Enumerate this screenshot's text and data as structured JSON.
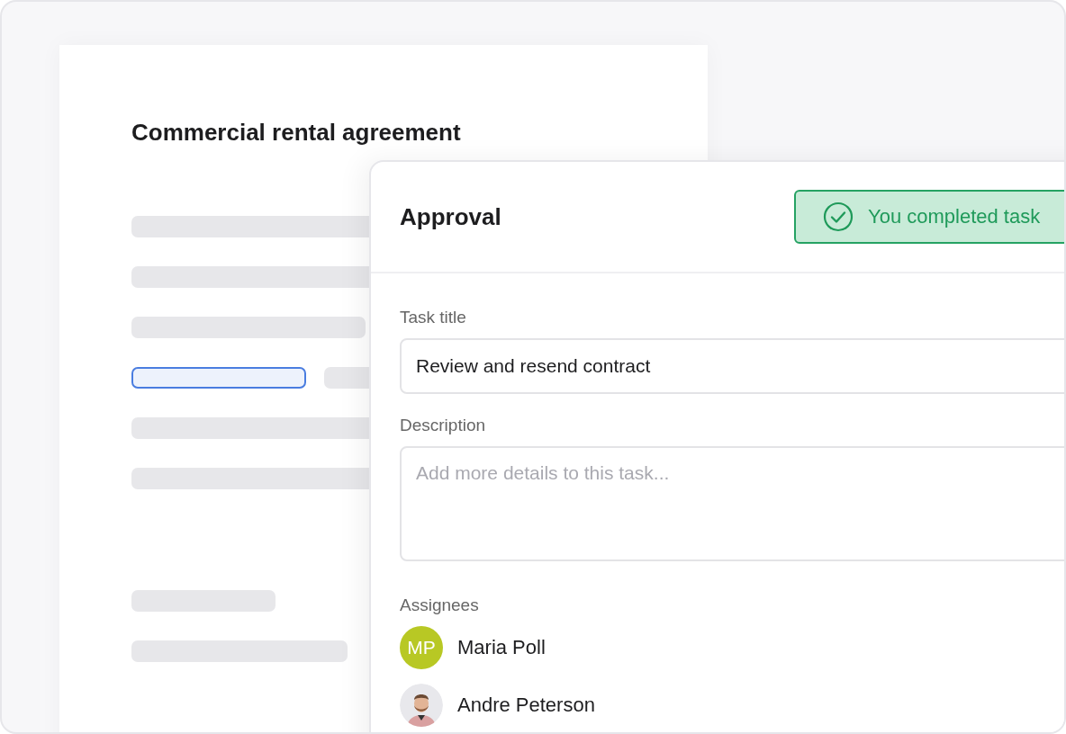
{
  "document": {
    "title": "Commercial rental agreement",
    "lines": [
      {
        "selected": false
      },
      {
        "selected": false
      },
      {
        "selected": false
      },
      {
        "selected": true
      },
      {
        "selected": false
      },
      {
        "selected": false
      },
      {
        "selected": false
      },
      {
        "selected": false
      }
    ]
  },
  "panel": {
    "title": "Approval",
    "badge": "You completed task",
    "fields": [
      {
        "label": "Task title",
        "value": "Review and resend contract",
        "kind": "input"
      },
      {
        "label": "Description",
        "placeholder": "Add more details to this task...",
        "kind": "textarea"
      }
    ],
    "assignees_label": "Assignees",
    "assignees": [
      {
        "name": "Maria Poll",
        "initials": "MP",
        "color": "#b8c824",
        "kind": "initials"
      },
      {
        "name": "Andre Peterson",
        "kind": "picture"
      }
    ]
  }
}
